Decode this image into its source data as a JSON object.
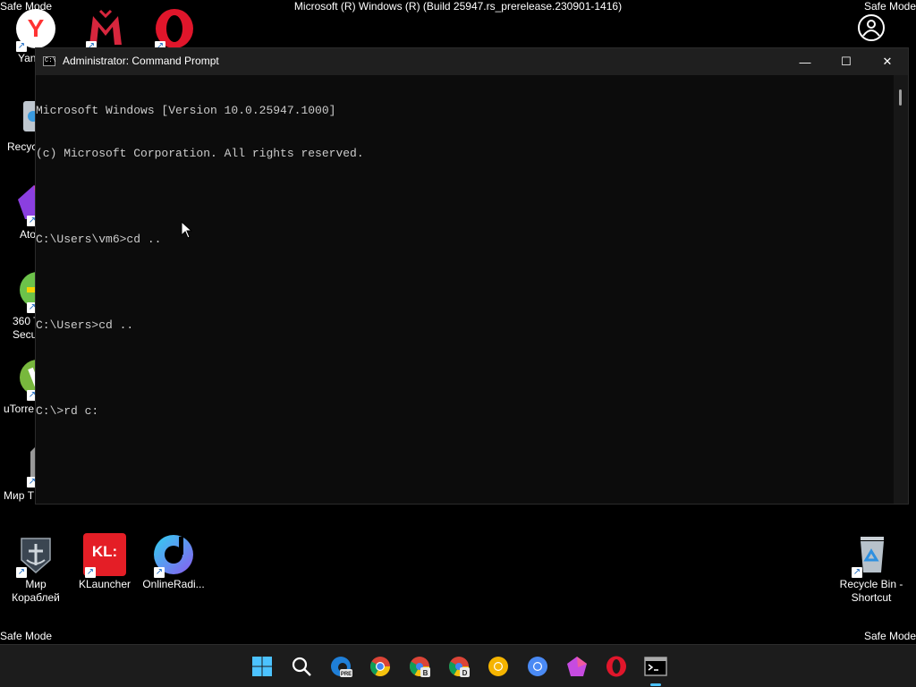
{
  "desktop": {
    "safe_mode_label": "Safe Mode",
    "build_text": "Microsoft (R) Windows (R) (Build 25947.rs_prerelease.230901-1416)",
    "left_icons": [
      {
        "name": "yandex",
        "label": "Yan"
      },
      {
        "name": "recycle-bin",
        "label": "Recyc"
      },
      {
        "name": "atom",
        "label": "Ato"
      },
      {
        "name": "360-security",
        "label": "360 T\nSecu"
      },
      {
        "name": "utorrent",
        "label": "uTorre"
      },
      {
        "name": "world-of-tanks",
        "label": "Мир Т"
      }
    ],
    "top_icons": [
      {
        "name": "mail-ru",
        "label": ""
      },
      {
        "name": "opera",
        "label": ""
      }
    ],
    "bottom_icons": [
      {
        "name": "world-of-warships",
        "label": "Мир\nКораблей"
      },
      {
        "name": "klauncher",
        "label": "KLauncher",
        "badge": "KL:"
      },
      {
        "name": "onlineradio",
        "label": "OnlineRadi..."
      },
      {
        "name": "recycle-bin-shortcut",
        "label": "Recycle Bin -\nShortcut"
      }
    ]
  },
  "window": {
    "title": "Administrator: Command Prompt",
    "icon_text": "C:\\",
    "controls": {
      "minimize": "—",
      "maximize": "☐",
      "close": "✕"
    },
    "console_lines": [
      "Microsoft Windows [Version 10.0.25947.1000]",
      "(c) Microsoft Corporation. All rights reserved.",
      "",
      "C:\\Users\\vm6>cd ..",
      "",
      "C:\\Users>cd ..",
      "",
      "C:\\>rd c:"
    ]
  },
  "taskbar": {
    "items": [
      "start",
      "search",
      "edge-beta",
      "chrome",
      "chrome-beta",
      "chrome-dev",
      "chrome-canary",
      "chromium",
      "pink-browser",
      "opera",
      "command-prompt"
    ],
    "badges": {
      "edge": "PRE",
      "beta": "B",
      "dev": "D"
    }
  },
  "colors": {
    "console_bg": "#0c0c0c",
    "console_text": "#cccccc",
    "taskbar_accent": "#4cc2ff"
  }
}
